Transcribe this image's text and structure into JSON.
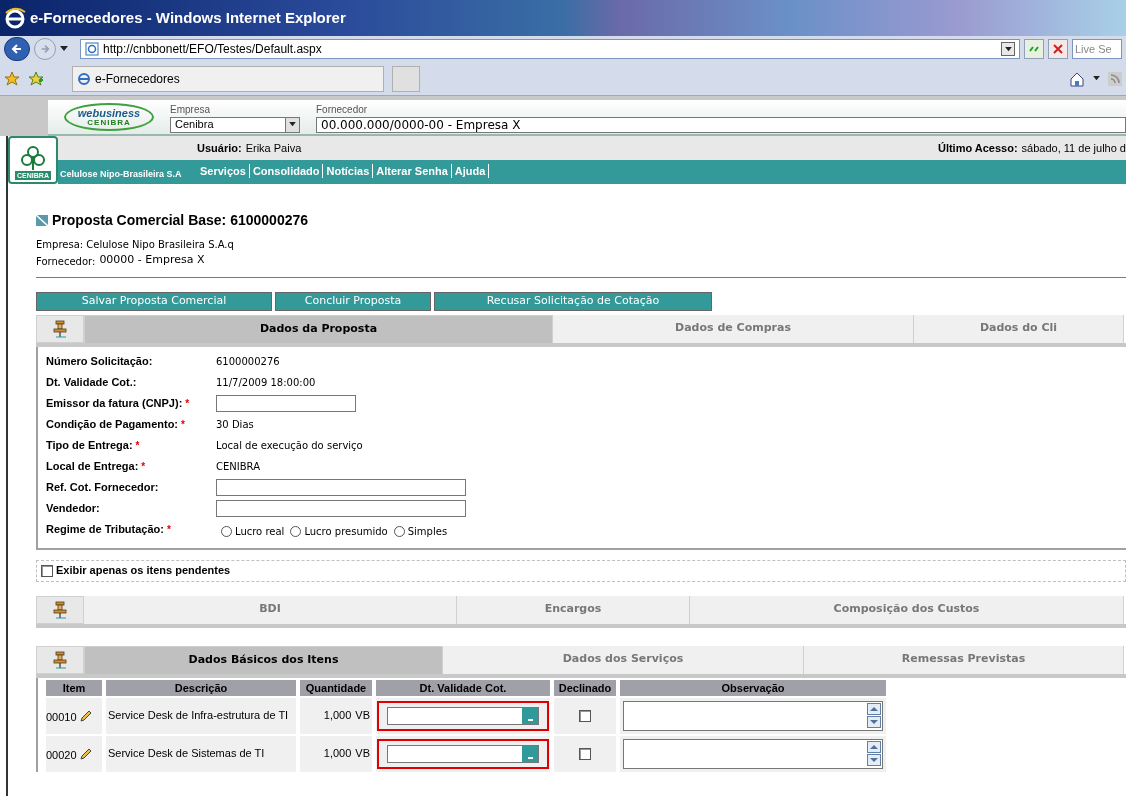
{
  "window": {
    "title": "e-Fornecedores - Windows Internet Explorer"
  },
  "browser": {
    "address": "http://cnbbonett/EFO/Testes/Default.aspx",
    "search_placeholder": "Live Se",
    "tab": "e-Fornecedores"
  },
  "header": {
    "logo": "webusiness",
    "logo_sub": "CENIBRA",
    "empresa_label": "Empresa",
    "empresa_value": "Cenibra",
    "fornecedor_label": "Fornecedor",
    "fornecedor_value": "00.000.000/0000-00 - Empresa X"
  },
  "company": {
    "logo": "CENIBRA",
    "name": "Celulose Nipo-Brasileira S.A"
  },
  "user_bar": {
    "user_label": "Usuário:",
    "user_name": "Erika Paiva",
    "last_access_label": "Último Acesso:",
    "last_access_value": "sábado, 11 de julho d"
  },
  "nav": [
    "Serviços",
    "Consolidado",
    "Notícias",
    "Alterar Senha",
    "Ajuda"
  ],
  "page": {
    "title": "Proposta Comercial Base: 6100000276",
    "empresa": "Empresa: Celulose Nipo Brasileira S.A.q",
    "fornecedor_label": "Fornecedor:",
    "fornecedor_value": "00000 - Empresa X"
  },
  "actions": [
    "Salvar Proposta Comercial",
    "Concluir Proposta",
    "Recusar Solicitação de Cotação"
  ],
  "proposal_tabs": [
    {
      "label": "Dados da Proposta",
      "selected": true
    },
    {
      "label": "Dados de Compras",
      "selected": false
    },
    {
      "label": "Dados do Cli",
      "selected": false
    }
  ],
  "fields": [
    {
      "label": "Número Solicitação:",
      "kind": "text",
      "value": "6100000276"
    },
    {
      "label": "Dt. Validade Cot.:",
      "kind": "text",
      "value": "11/7/2009 18:00:00"
    },
    {
      "label": "Emissor da fatura (CNPJ):",
      "marker": "*",
      "kind": "short_input"
    },
    {
      "label": "Condição de Pagamento:",
      "marker": "*",
      "kind": "text",
      "value": "30 Dias"
    },
    {
      "label": "Tipo de Entrega:",
      "marker": "*",
      "kind": "text",
      "value": "Local de execução do serviço"
    },
    {
      "label": "Local de Entrega:",
      "marker": "*",
      "kind": "text",
      "value": "CENIBRA"
    },
    {
      "label": "Ref. Cot. Fornecedor:",
      "kind": "input"
    },
    {
      "label": "Vendedor:",
      "kind": "input"
    },
    {
      "label": "Regime de Tributação:",
      "marker": "*",
      "kind": "radio",
      "options": [
        {
          "label": "Lucro real",
          "selected": false
        },
        {
          "label": "Lucro presumido",
          "selected": false
        },
        {
          "label": "Simples",
          "selected": false
        }
      ]
    }
  ],
  "pending_filter": {
    "label": "Exibir apenas os itens pendentes",
    "checked": false
  },
  "cost_tabs": [
    {
      "label": "BDI",
      "selected": false
    },
    {
      "label": "Encargos",
      "selected": false
    },
    {
      "label": "Composição dos Custos",
      "selected": false
    }
  ],
  "item_tabs": [
    {
      "label": "Dados Básicos dos Itens",
      "selected": true
    },
    {
      "label": "Dados dos Serviços",
      "selected": false
    },
    {
      "label": "Remessas Previstas",
      "selected": false
    }
  ],
  "table": {
    "columns": [
      "Item",
      "Descrição",
      "Quantidade",
      "Dt. Validade Cot.",
      "Declinado",
      "Observação"
    ],
    "rows": [
      {
        "item": "00010",
        "description": "Service Desk de Infra-estrutura de TI",
        "quantity": "1,000",
        "unit": "VB",
        "date_highlighted": true,
        "declined": false
      },
      {
        "item": "00020",
        "description": "Service Desk de Sistemas de TI",
        "quantity": "1,000",
        "unit": "VB",
        "date_highlighted": true,
        "declined": false
      }
    ]
  }
}
